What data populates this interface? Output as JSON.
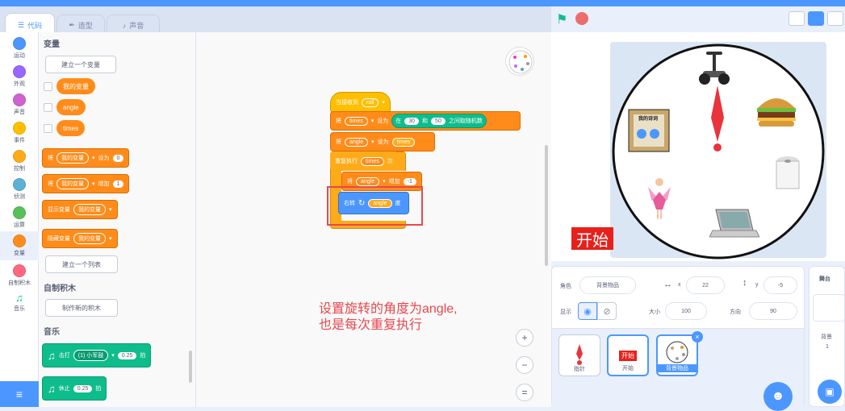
{
  "tabs": {
    "code": "代码",
    "costumes": "造型",
    "sounds": "声音"
  },
  "categories": [
    {
      "label": "运动",
      "color": "#4c97ff"
    },
    {
      "label": "外观",
      "color": "#9966ff"
    },
    {
      "label": "声音",
      "color": "#cf63cf"
    },
    {
      "label": "事件",
      "color": "#ffbf00"
    },
    {
      "label": "控制",
      "color": "#ffab19"
    },
    {
      "label": "侦测",
      "color": "#5cb1d6"
    },
    {
      "label": "运算",
      "color": "#59c059"
    },
    {
      "label": "变量",
      "color": "#ff8c1a"
    },
    {
      "label": "自制积木",
      "color": "#ff6680"
    },
    {
      "label": "音乐",
      "color": "#0fbd8c"
    }
  ],
  "palette": {
    "variables_heading": "变量",
    "make_variable": "建立一个变量",
    "vars": [
      "我的变量",
      "angle",
      "times"
    ],
    "set_block": {
      "verb": "将",
      "var": "我的变量",
      "op": "设为",
      "value": "0"
    },
    "change_block": {
      "verb": "将",
      "var": "我的变量",
      "op": "增加",
      "value": "1"
    },
    "show_block": {
      "op": "显示变量",
      "var": "我的变量"
    },
    "hide_block": {
      "op": "隐藏变量",
      "var": "我的变量"
    },
    "make_list": "建立一个列表",
    "myblocks_heading": "自制积木",
    "make_block": "制作新的积木",
    "music_heading": "音乐",
    "drum_block": {
      "op": "击打",
      "drum": "(1) 小军鼓",
      "value": "0.25",
      "unit": "拍"
    },
    "rest_block": {
      "op": "休止",
      "value": "0.25",
      "unit": "拍"
    }
  },
  "script": {
    "hat": {
      "label": "当接收到",
      "msg": "roll"
    },
    "set_times": {
      "verb": "将",
      "var": "times",
      "op": "设为",
      "rand_a": "在",
      "from": "30",
      "and": "和",
      "to": "50",
      "rand_b": "之间取随机数"
    },
    "set_angle": {
      "verb": "将",
      "var": "angle",
      "op": "设为",
      "value": "times"
    },
    "repeat": {
      "label": "重复执行",
      "value": "times",
      "unit": "次"
    },
    "change_angle": {
      "verb": "将",
      "var": "angle",
      "op": "增加",
      "value": "-1"
    },
    "turn": {
      "op": "右转",
      "value": "angle",
      "unit": "度"
    }
  },
  "annotation": {
    "line1": "设置旋转的角度为angle,",
    "line2": "也是每次重复执行"
  },
  "zoom": {
    "in": "+",
    "out": "−",
    "reset": "="
  },
  "stage": {
    "start_label": "开始",
    "book_title": "我的诗词"
  },
  "sprite_info": {
    "sprite_label": "角色",
    "sprite_name": "背景物品",
    "x_label": "x",
    "x_value": "22",
    "y_label": "y",
    "y_value": "-5",
    "show_label": "显示",
    "size_label": "大小",
    "size_value": "100",
    "direction_label": "方向",
    "direction_value": "90"
  },
  "sprites": [
    {
      "name": "指针"
    },
    {
      "name": "开始"
    },
    {
      "name": "背景物品"
    }
  ],
  "stage_panel": {
    "title": "舞台",
    "backdrops_label": "背景",
    "backdrops_count": "1"
  }
}
